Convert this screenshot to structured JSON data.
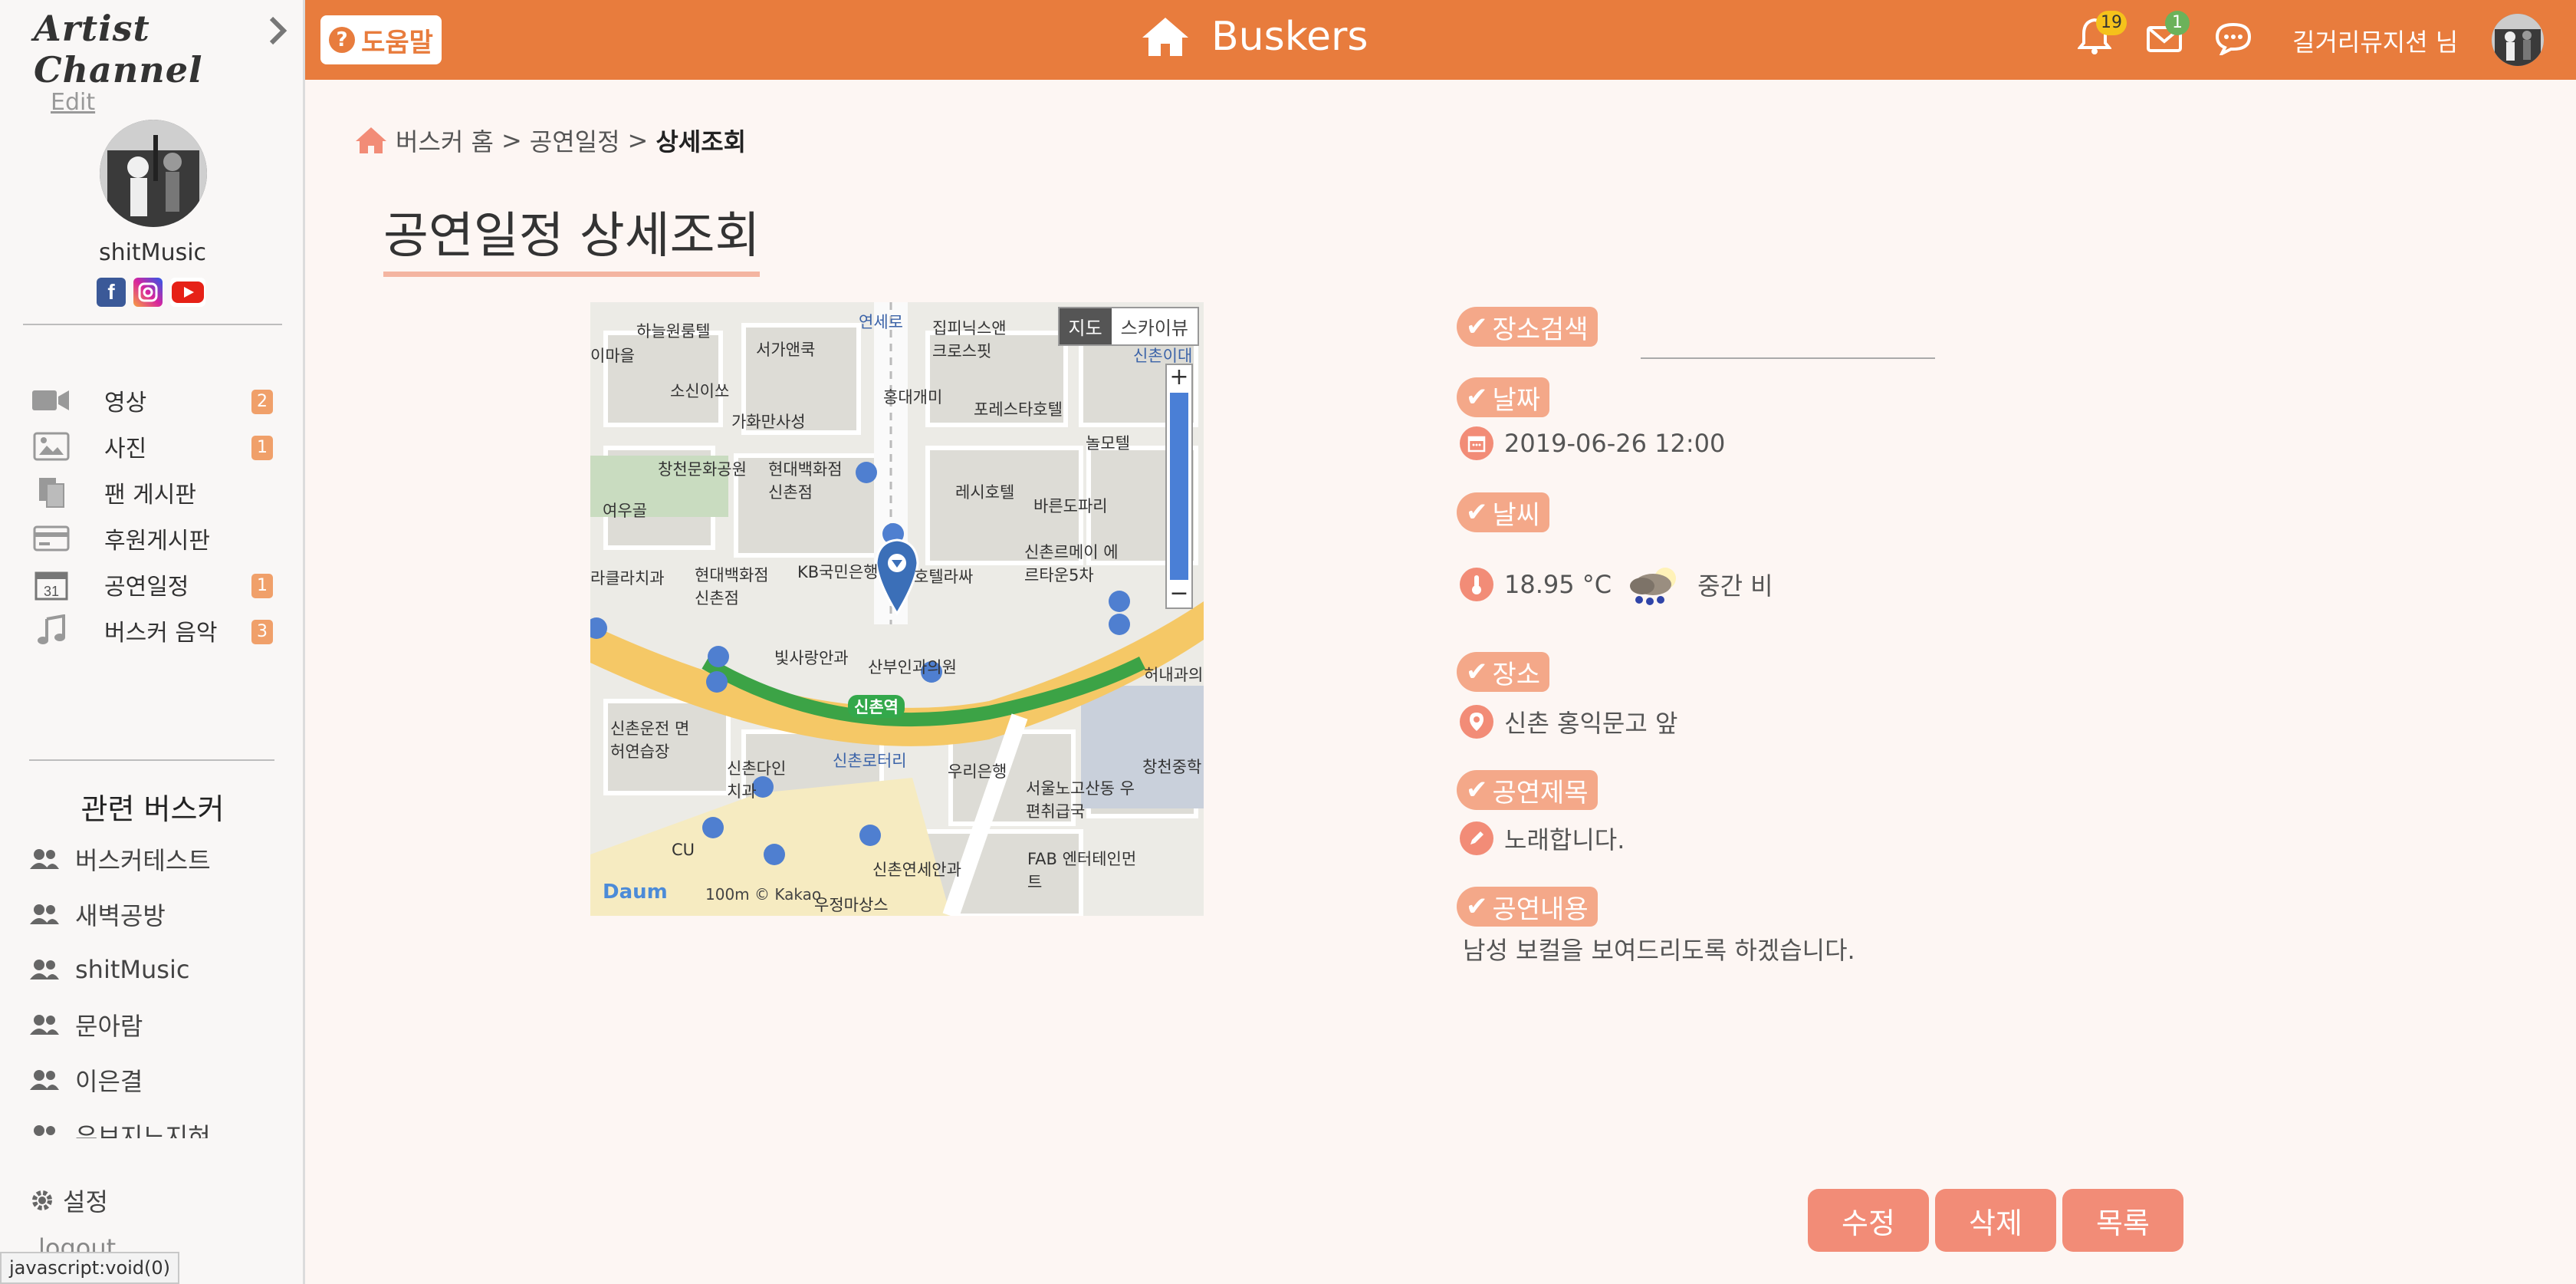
{
  "sidebar": {
    "brand": "Artist Channel",
    "edit_label": "Edit",
    "profile_name": "shitMusic",
    "menu": [
      {
        "label": "영상",
        "badge": "2",
        "icon": "video-icon"
      },
      {
        "label": "사진",
        "badge": "1",
        "icon": "photo-icon"
      },
      {
        "label": "팬 게시판",
        "badge": "",
        "icon": "clipboard-icon"
      },
      {
        "label": "후원게시판",
        "badge": "",
        "icon": "credit-card-icon"
      },
      {
        "label": "공연일정",
        "badge": "1",
        "icon": "calendar-icon"
      },
      {
        "label": "버스커 음악",
        "badge": "3",
        "icon": "music-note-icon"
      }
    ],
    "related_title": "관련 버스커",
    "related": [
      "버스커테스트",
      "새벽공방",
      "shitMusic",
      "문아람",
      "이은결",
      "유브지느지혀"
    ],
    "settings_label": "설정",
    "logout_label": "logout"
  },
  "statusbar": "javascript:void(0)",
  "header": {
    "help_label": "도움말",
    "title": "Buskers",
    "notifications_count": "19",
    "messages_count": "1",
    "user_label": "길거리뮤지션 님",
    "accent": "#e87c3d"
  },
  "breadcrumb": {
    "home": "버스커 홈",
    "section": "공연일정",
    "current": "상세조회"
  },
  "page_title": "공연일정 상세조회",
  "map": {
    "toggle_map": "지도",
    "toggle_sky": "스카이뷰",
    "logo": "Daum",
    "copyright": "100m © Kakao",
    "labels": {
      "l1": "하늘원룸텔",
      "l2": "서가앤쿡",
      "l3": "연세로",
      "l4": "집피닉스앤 크로스핏",
      "l5": "신촌이대",
      "l6": "소신이쏘",
      "l7": "홍대개미",
      "l8": "포레스타호텔",
      "l9": "가화만사성",
      "l10": "놀모텔",
      "l11": "창천문화공원",
      "l12": "현대백화점 신촌점",
      "l13": "레시호텔",
      "l14": "바른도파리",
      "l15": "여우골",
      "l16": "신촌르메이 에르타운5차",
      "l17": "현대백화점 신촌점",
      "l18": "KB국민은행",
      "l19": "호텔라싸",
      "l20": "빛사랑안과",
      "l21": "산부인과의원",
      "l22": "허내과의",
      "l23": "신촌역",
      "l24": "신촌운전 면허연습장",
      "l25": "신촌다인 치과",
      "l26": "신촌로터리",
      "l27": "우리은행",
      "l28": "서울노고산동 우편취급국",
      "l29": "창천중학",
      "l30": "CU",
      "l31": "신촌연세안과",
      "l32": "FAB 엔터테인먼트",
      "l33": "우정마상스",
      "l34": "이마을",
      "l35": "라클라치과"
    }
  },
  "details": {
    "place_search_label": "장소검색",
    "place_search_value": "",
    "date_label": "날짜",
    "date_value": "2019-06-26 12:00",
    "weather_label": "날씨",
    "temperature": "18.95 °C",
    "weather_desc": "중간 비",
    "place_label": "장소",
    "place_value": "신촌 홍익문고 앞",
    "title_label": "공연제목",
    "title_value": "노래합니다.",
    "content_label": "공연내용",
    "content_value": "남성 보컬을 보여드리도록 하겠습니다."
  },
  "actions": {
    "edit": "수정",
    "delete": "삭제",
    "list": "목록",
    "button_color": "#f28c77"
  }
}
